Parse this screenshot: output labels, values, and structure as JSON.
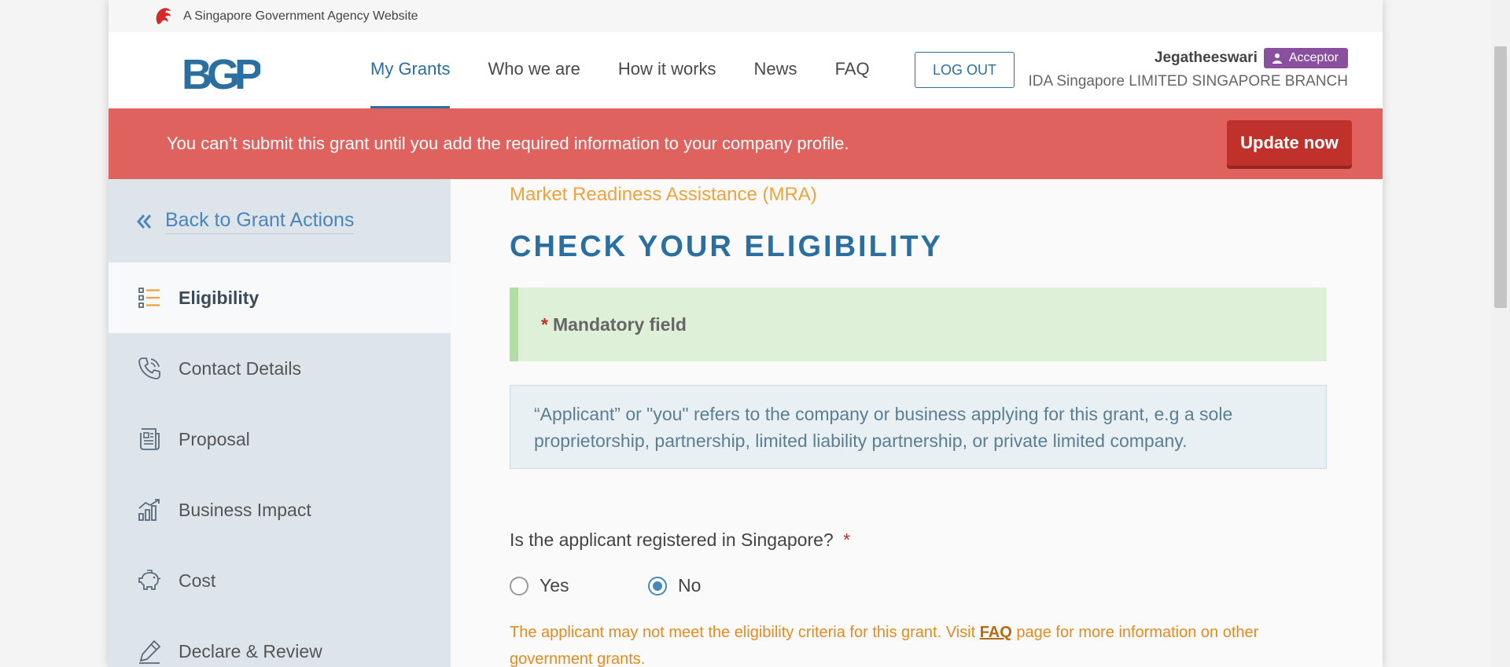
{
  "masthead": {
    "text": "A Singapore Government Agency Website"
  },
  "header": {
    "logo": "BGP",
    "nav": [
      "My Grants",
      "Who we are",
      "How it works",
      "News",
      "FAQ"
    ],
    "logout_label": "LOG OUT",
    "user": {
      "name": "Jegatheeswari",
      "role": "Acceptor",
      "company": "IDA Singapore LIMITED SINGAPORE BRANCH"
    }
  },
  "alert": {
    "message": "You can’t submit this grant until you add the required information to your company profile.",
    "button_label": "Update now"
  },
  "sidebar": {
    "back_label": "Back to Grant Actions",
    "items": [
      {
        "label": "Eligibility",
        "icon": "list-icon"
      },
      {
        "label": "Contact Details",
        "icon": "phone-icon"
      },
      {
        "label": "Proposal",
        "icon": "document-icon"
      },
      {
        "label": "Business Impact",
        "icon": "bar-chart-icon"
      },
      {
        "label": "Cost",
        "icon": "piggy-bank-icon"
      },
      {
        "label": "Declare & Review",
        "icon": "pen-icon"
      }
    ],
    "active_index": 0
  },
  "main": {
    "subtitle": "Market Readiness Assistance (MRA)",
    "heading": "CHECK YOUR ELIGIBILITY",
    "mandatory_label": "Mandatory field",
    "info_text": "“Applicant” or \"you\" refers to the company or business applying for this grant, e.g a sole proprietorship, partnership, limited liability partnership, or private limited company.",
    "question": "Is the applicant registered in Singapore?",
    "options": [
      "Yes",
      "No"
    ],
    "selected": "No",
    "warning_before": "The applicant may not meet the eligibility criteria for this grant. Visit ",
    "warning_link": "FAQ",
    "warning_after": " page for more information on other government grants."
  },
  "colors": {
    "accent": "#2a6fa0",
    "alert_bg": "#e0625e",
    "update_button": "#c0312b",
    "subtitle": "#f0a23c",
    "role_badge": "#8a4f9e",
    "sidebar_bg": "#dde4ea"
  }
}
